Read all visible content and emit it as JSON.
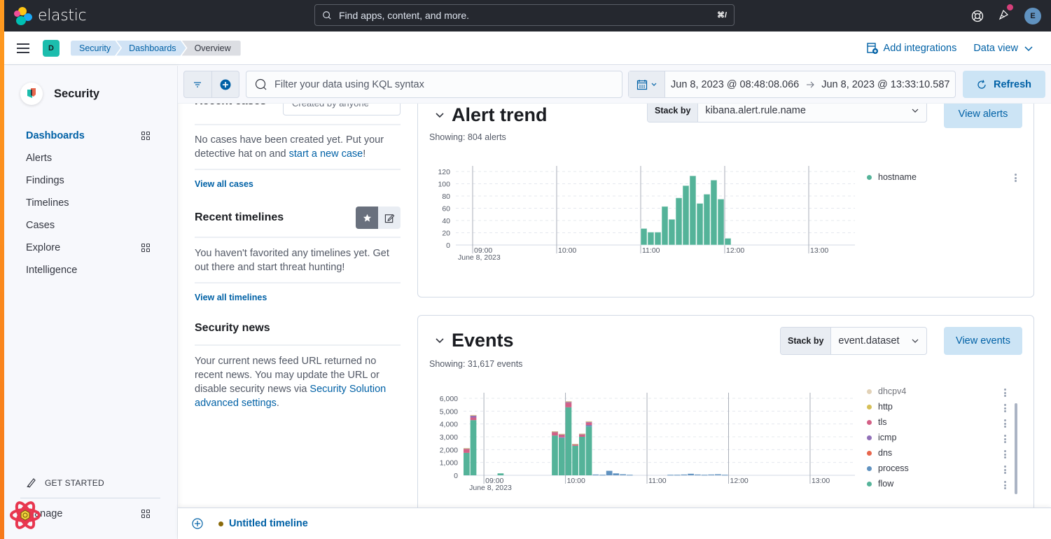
{
  "app": {
    "brand": "elastic",
    "global_search_placeholder": "Find apps, content, and more.",
    "global_search_shortcut": "⌘/",
    "user_initial": "E",
    "space_initial": "D"
  },
  "breadcrumbs": [
    "Security",
    "Dashboards",
    "Overview"
  ],
  "header_actions": {
    "add_integrations": "Add integrations",
    "data_view": "Data view"
  },
  "sidebar": {
    "title": "Security",
    "items": [
      {
        "label": "Dashboards",
        "active": true,
        "has_grid": true
      },
      {
        "label": "Alerts"
      },
      {
        "label": "Findings"
      },
      {
        "label": "Timelines"
      },
      {
        "label": "Cases"
      },
      {
        "label": "Explore",
        "has_grid": true
      },
      {
        "label": "Intelligence"
      }
    ],
    "get_started": "GET STARTED",
    "manage": "Manage"
  },
  "query_bar": {
    "kql_placeholder": "Filter your data using KQL syntax",
    "date_start": "Jun 8, 2023 @ 08:48:08.066",
    "date_end": "Jun 8, 2023 @ 13:33:10.587",
    "refresh": "Refresh"
  },
  "recent_cases": {
    "title": "Recent cases",
    "filter": "Created by anyone",
    "empty_text": "No cases have been created yet. Put your detective hat on and ",
    "empty_link": "start a new case",
    "empty_suffix": "!",
    "view_all": "View all cases"
  },
  "recent_timelines": {
    "title": "Recent timelines",
    "empty_text": "You haven't favorited any timelines yet. Get out there and start threat hunting!",
    "view_all": "View all timelines"
  },
  "security_news": {
    "title": "Security news",
    "text": "Your current news feed URL returned no recent news. You may update the URL or disable security news via ",
    "link": "Security Solution advanced settings",
    "suffix": "."
  },
  "alert_trend": {
    "title": "Alert trend",
    "showing": "Showing: 804 alerts",
    "stack_by_label": "Stack by",
    "stack_by_value": "kibana.alert.rule.name",
    "view_button": "View alerts",
    "legend": [
      {
        "label": "hostname",
        "color": "#54b399"
      }
    ]
  },
  "events": {
    "title": "Events",
    "showing": "Showing: 31,617 events",
    "stack_by_label": "Stack by",
    "stack_by_value": "event.dataset",
    "view_button": "View events",
    "legend": [
      {
        "label": "dhcpv4",
        "color": "#d6bf9a"
      },
      {
        "label": "http",
        "color": "#d6bf57"
      },
      {
        "label": "tls",
        "color": "#d36086"
      },
      {
        "label": "icmp",
        "color": "#9170b8"
      },
      {
        "label": "dns",
        "color": "#e7664c"
      },
      {
        "label": "process",
        "color": "#6092c0"
      },
      {
        "label": "flow",
        "color": "#54b399"
      }
    ]
  },
  "timeline_bar": {
    "title": "Untitled timeline"
  },
  "chart_data": [
    {
      "type": "bar",
      "title": "Alert trend",
      "xlabel": "",
      "ylabel": "",
      "ylim": [
        0,
        120
      ],
      "yticks": [
        "0",
        "20",
        "40",
        "60",
        "80",
        "100",
        "120"
      ],
      "xticks": [
        {
          "label": "09:00",
          "sub": "June 8, 2023",
          "t": 9.0
        },
        {
          "label": "10:00",
          "t": 10.0
        },
        {
          "label": "11:00",
          "t": 11.0
        },
        {
          "label": "12:00",
          "t": 12.0
        },
        {
          "label": "13:00",
          "t": 13.0
        }
      ],
      "x_range": [
        8.8,
        13.55
      ],
      "interval_hours": 0.0833,
      "series": [
        {
          "name": "hostname",
          "color": "#54b399",
          "x": [
            11.0,
            11.083,
            11.167,
            11.25,
            11.333,
            11.417,
            11.5,
            11.583,
            11.667,
            11.75,
            11.833,
            11.917,
            12.0
          ],
          "values": [
            27,
            21,
            21,
            63,
            42,
            77,
            97,
            113,
            68,
            83,
            106,
            75,
            11
          ]
        }
      ],
      "grid": true,
      "legend": "right"
    },
    {
      "type": "bar",
      "stacked": true,
      "title": "Events",
      "ylim": [
        0,
        6000
      ],
      "yticks": [
        "0",
        "1,000",
        "2,000",
        "3,000",
        "4,000",
        "5,000",
        "6,000"
      ],
      "xticks": [
        {
          "label": "09:00",
          "sub": "June 8, 2023",
          "t": 9.0
        },
        {
          "label": "10:00",
          "t": 10.0
        },
        {
          "label": "11:00",
          "t": 11.0
        },
        {
          "label": "12:00",
          "t": 12.0
        },
        {
          "label": "13:00",
          "t": 13.0
        }
      ],
      "x_range": [
        8.75,
        13.55
      ],
      "interval_hours": 0.0833,
      "x": [
        8.75,
        8.833,
        9.167,
        9.833,
        9.917,
        10.0,
        10.083,
        10.167,
        10.25,
        10.333,
        10.417,
        10.5,
        10.583,
        10.667,
        10.75,
        11.25,
        11.333,
        11.417,
        11.5,
        11.583,
        11.667,
        11.75,
        11.833,
        11.917
      ],
      "series": [
        {
          "name": "flow",
          "color": "#54b399",
          "values": [
            1750,
            4300,
            150,
            3100,
            2900,
            5300,
            2300,
            3000,
            3800,
            0,
            0,
            0,
            0,
            0,
            0,
            0,
            0,
            0,
            0,
            0,
            0,
            0,
            0,
            0
          ]
        },
        {
          "name": "process",
          "color": "#6092c0",
          "values": [
            0,
            0,
            0,
            0,
            60,
            0,
            0,
            0,
            100,
            60,
            40,
            350,
            150,
            80,
            40,
            40,
            40,
            60,
            120,
            60,
            40,
            60,
            80,
            40
          ]
        },
        {
          "name": "dns",
          "color": "#d36086",
          "values": [
            300,
            200,
            0,
            250,
            180,
            350,
            100,
            180,
            200,
            0,
            0,
            0,
            0,
            0,
            0,
            0,
            0,
            0,
            0,
            0,
            0,
            0,
            0,
            0
          ]
        },
        {
          "name": "icmp",
          "color": "#9170b8",
          "values": [
            30,
            150,
            0,
            40,
            50,
            60,
            20,
            30,
            60,
            0,
            0,
            0,
            0,
            0,
            0,
            0,
            0,
            0,
            0,
            0,
            0,
            0,
            0,
            0
          ]
        },
        {
          "name": "tls",
          "color": "#d36086",
          "values": [
            20,
            30,
            0,
            20,
            20,
            40,
            10,
            20,
            30,
            0,
            0,
            0,
            0,
            0,
            0,
            0,
            0,
            0,
            0,
            0,
            0,
            0,
            0,
            0
          ]
        },
        {
          "name": "http",
          "color": "#d6bf57",
          "values": [
            10,
            10,
            0,
            10,
            10,
            10,
            10,
            10,
            10,
            0,
            0,
            0,
            0,
            0,
            0,
            0,
            0,
            0,
            0,
            0,
            0,
            0,
            0,
            0
          ]
        },
        {
          "name": "dhcpv4",
          "color": "#d6bf9a",
          "values": [
            10,
            10,
            0,
            10,
            10,
            10,
            10,
            10,
            10,
            0,
            0,
            0,
            0,
            0,
            0,
            0,
            0,
            0,
            0,
            0,
            0,
            0,
            0,
            0
          ]
        }
      ],
      "grid": true,
      "legend": "right"
    }
  ]
}
